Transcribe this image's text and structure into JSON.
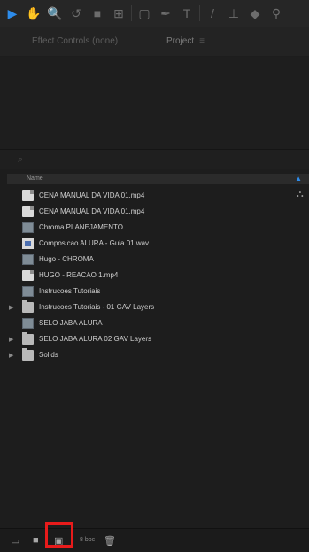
{
  "toolbar": {
    "tools": [
      {
        "name": "selection-icon",
        "glyph": "▶",
        "active": true
      },
      {
        "name": "hand-icon",
        "glyph": "✋"
      },
      {
        "name": "zoom-icon",
        "glyph": "🔍"
      },
      {
        "name": "rotate-icon",
        "glyph": "↺"
      },
      {
        "name": "camera-icon",
        "glyph": "■"
      },
      {
        "name": "pan-behind-icon",
        "glyph": "⊞"
      },
      {
        "name": "rectangle-icon",
        "glyph": "▢"
      },
      {
        "name": "pen-icon",
        "glyph": "✒"
      },
      {
        "name": "type-icon",
        "glyph": "T"
      },
      {
        "name": "brush-icon",
        "glyph": "/"
      },
      {
        "name": "clone-icon",
        "glyph": "⊥"
      },
      {
        "name": "eraser-icon",
        "glyph": "◆"
      },
      {
        "name": "roto-icon",
        "glyph": "⚲"
      }
    ]
  },
  "panel": {
    "tab_effect_controls": "Effect Controls (none)",
    "tab_project": "Project",
    "tab_menu": "≡"
  },
  "search": {
    "icon": "⌕"
  },
  "columns": {
    "name": "Name",
    "sort_indicator": "▲"
  },
  "items": [
    {
      "label": "CENA MANUAL DA VIDA 01.mp4",
      "type": "file",
      "twirl": ""
    },
    {
      "label": "CENA MANUAL DA VIDA 01.mp4",
      "type": "file",
      "twirl": ""
    },
    {
      "label": "Chroma PLANEJAMENTO",
      "type": "comp",
      "twirl": ""
    },
    {
      "label": "Composicao ALURA - Guia 01.wav",
      "type": "audio",
      "twirl": ""
    },
    {
      "label": "Hugo - CHROMA",
      "type": "comp",
      "twirl": ""
    },
    {
      "label": "HUGO - REACAO 1.mp4",
      "type": "file",
      "twirl": ""
    },
    {
      "label": "Instrucoes Tutoriais",
      "type": "comp",
      "twirl": ""
    },
    {
      "label": "Instrucoes Tutoriais - 01 GAV Layers",
      "type": "folder",
      "twirl": "▶"
    },
    {
      "label": "SELO JABA ALURA",
      "type": "comp",
      "twirl": ""
    },
    {
      "label": "SELO JABA ALURA 02 GAV Layers",
      "type": "folder",
      "twirl": "▶"
    },
    {
      "label": "Solids",
      "type": "folder",
      "twirl": "▶"
    }
  ],
  "bottom": {
    "interpret_icon": "▭",
    "new_folder_icon": "■",
    "new_comp_icon": "▣",
    "bpc_label": "8 bpc",
    "delete_icon": "🗑"
  },
  "colors": {
    "accent": "#2d8ceb",
    "highlight": "#e81b1b"
  }
}
